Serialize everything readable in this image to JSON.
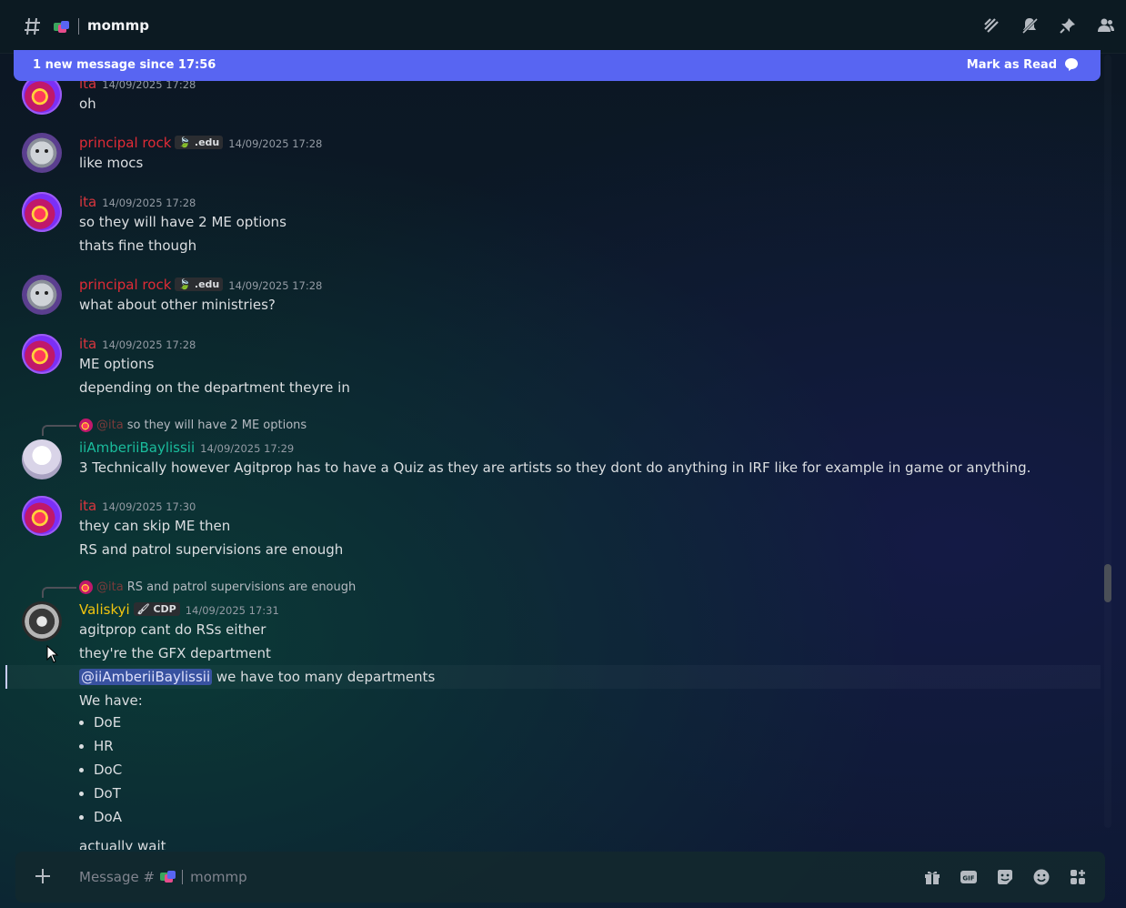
{
  "header": {
    "channel_title": "mommp",
    "icons": [
      "threads-icon",
      "mute-bell-icon",
      "pin-icon",
      "members-icon"
    ]
  },
  "banner": {
    "text": "1 new message since 17:56",
    "mark_read": "Mark as Read"
  },
  "messages": [
    {
      "author": "ita",
      "time": "14/09/2025 17:28",
      "lines": [
        "oh"
      ]
    },
    {
      "author": "principal rock",
      "tag": ".edu",
      "time": "14/09/2025 17:28",
      "lines": [
        "like mocs"
      ]
    },
    {
      "author": "ita",
      "time": "14/09/2025 17:28",
      "lines": [
        "so they will have 2 ME options",
        "thats fine though"
      ]
    },
    {
      "author": "principal rock",
      "tag": ".edu",
      "time": "14/09/2025 17:28",
      "lines": [
        "what about other ministries?"
      ]
    },
    {
      "author": "ita",
      "time": "14/09/2025 17:28",
      "lines": [
        "ME options",
        "depending on the department theyre in"
      ]
    },
    {
      "reply_to": "@ita",
      "reply_text": "so they will have 2 ME options",
      "author": "iiAmberiiBaylissii",
      "time": "14/09/2025 17:29",
      "lines": [
        "3 Technically however Agitprop has to have a Quiz as they are artists so they dont do anything in IRF like for example in game or anything."
      ]
    },
    {
      "author": "ita",
      "time": "14/09/2025 17:30",
      "lines": [
        "they can skip ME then",
        "RS and patrol supervisions are enough"
      ]
    },
    {
      "reply_to": "@ita",
      "reply_text": "RS and patrol supervisions are enough",
      "author": "Valiskyi",
      "tag": "CDP",
      "time": "14/09/2025 17:31",
      "lines": [
        "agitprop cant do RSs either",
        "they're the GFX department"
      ],
      "mention": "@iiAmberiiBaylissii",
      "mention_rest": "we have too many departments",
      "list_intro": "We have:",
      "list": [
        "DoE",
        "HR",
        "DoC",
        "DoT",
        "DoA"
      ],
      "last_line": "actually wait"
    }
  ],
  "composer": {
    "placeholder_prefix": "Message #",
    "placeholder_channel": "mommp",
    "icons": [
      "gift-icon",
      "gif-icon",
      "sticker-icon",
      "emoji-icon",
      "apps-icon"
    ]
  },
  "colors": {
    "ita": "#d9363e",
    "principal_rock": "#e02b36",
    "amber": "#1abc9c",
    "valiskyi": "#f1c40f",
    "accent": "#5865f2"
  }
}
